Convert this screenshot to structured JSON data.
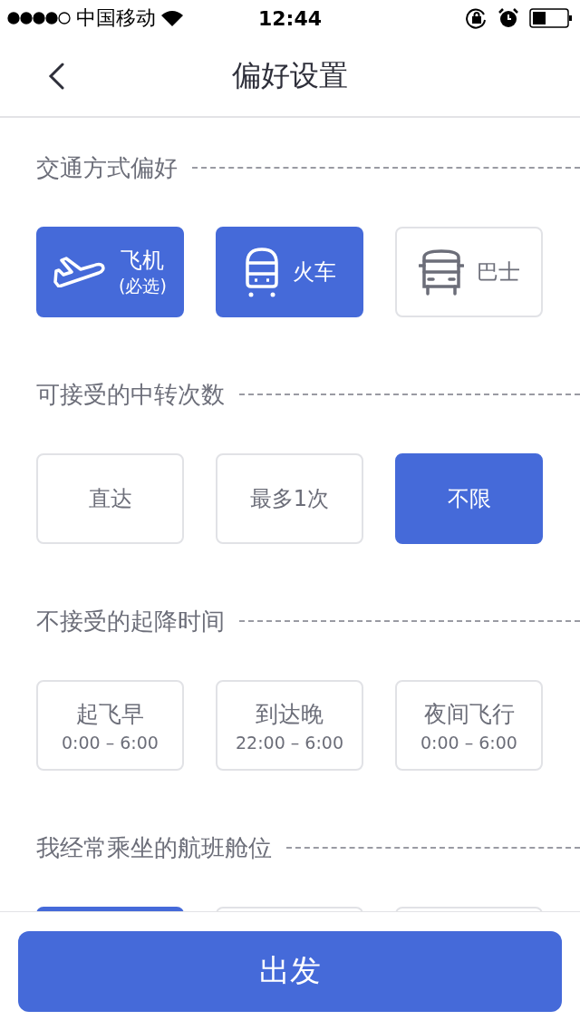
{
  "status_bar": {
    "carrier": "中国移动",
    "time": "12:44"
  },
  "nav": {
    "title": "偏好设置"
  },
  "sections": [
    {
      "title": "交通方式偏好",
      "options": [
        {
          "kind": "icon",
          "label": "飞机",
          "sub": "(必选)",
          "selected": true
        },
        {
          "kind": "icon",
          "label": "火车",
          "selected": true
        },
        {
          "kind": "icon",
          "label": "巴士",
          "selected": false
        }
      ]
    },
    {
      "title": "可接受的中转次数",
      "options": [
        {
          "kind": "text",
          "label": "直达",
          "selected": false
        },
        {
          "kind": "text",
          "label": "最多1次",
          "selected": false
        },
        {
          "kind": "text",
          "label": "不限",
          "selected": true
        }
      ]
    },
    {
      "title": "不接受的起降时间",
      "options": [
        {
          "kind": "time",
          "label": "起飞早",
          "sub": "0:00 – 6:00",
          "selected": false
        },
        {
          "kind": "time",
          "label": "到达晚",
          "sub": "22:00 – 6:00",
          "selected": false
        },
        {
          "kind": "time",
          "label": "夜间飞行",
          "sub": "0:00 – 6:00",
          "selected": false
        }
      ]
    },
    {
      "title": "我经常乘坐的航班舱位",
      "options": [
        {
          "kind": "hidden",
          "selected": true
        },
        {
          "kind": "hidden",
          "selected": false
        },
        {
          "kind": "hidden",
          "selected": false
        }
      ]
    }
  ],
  "footer": {
    "button": "出发"
  }
}
